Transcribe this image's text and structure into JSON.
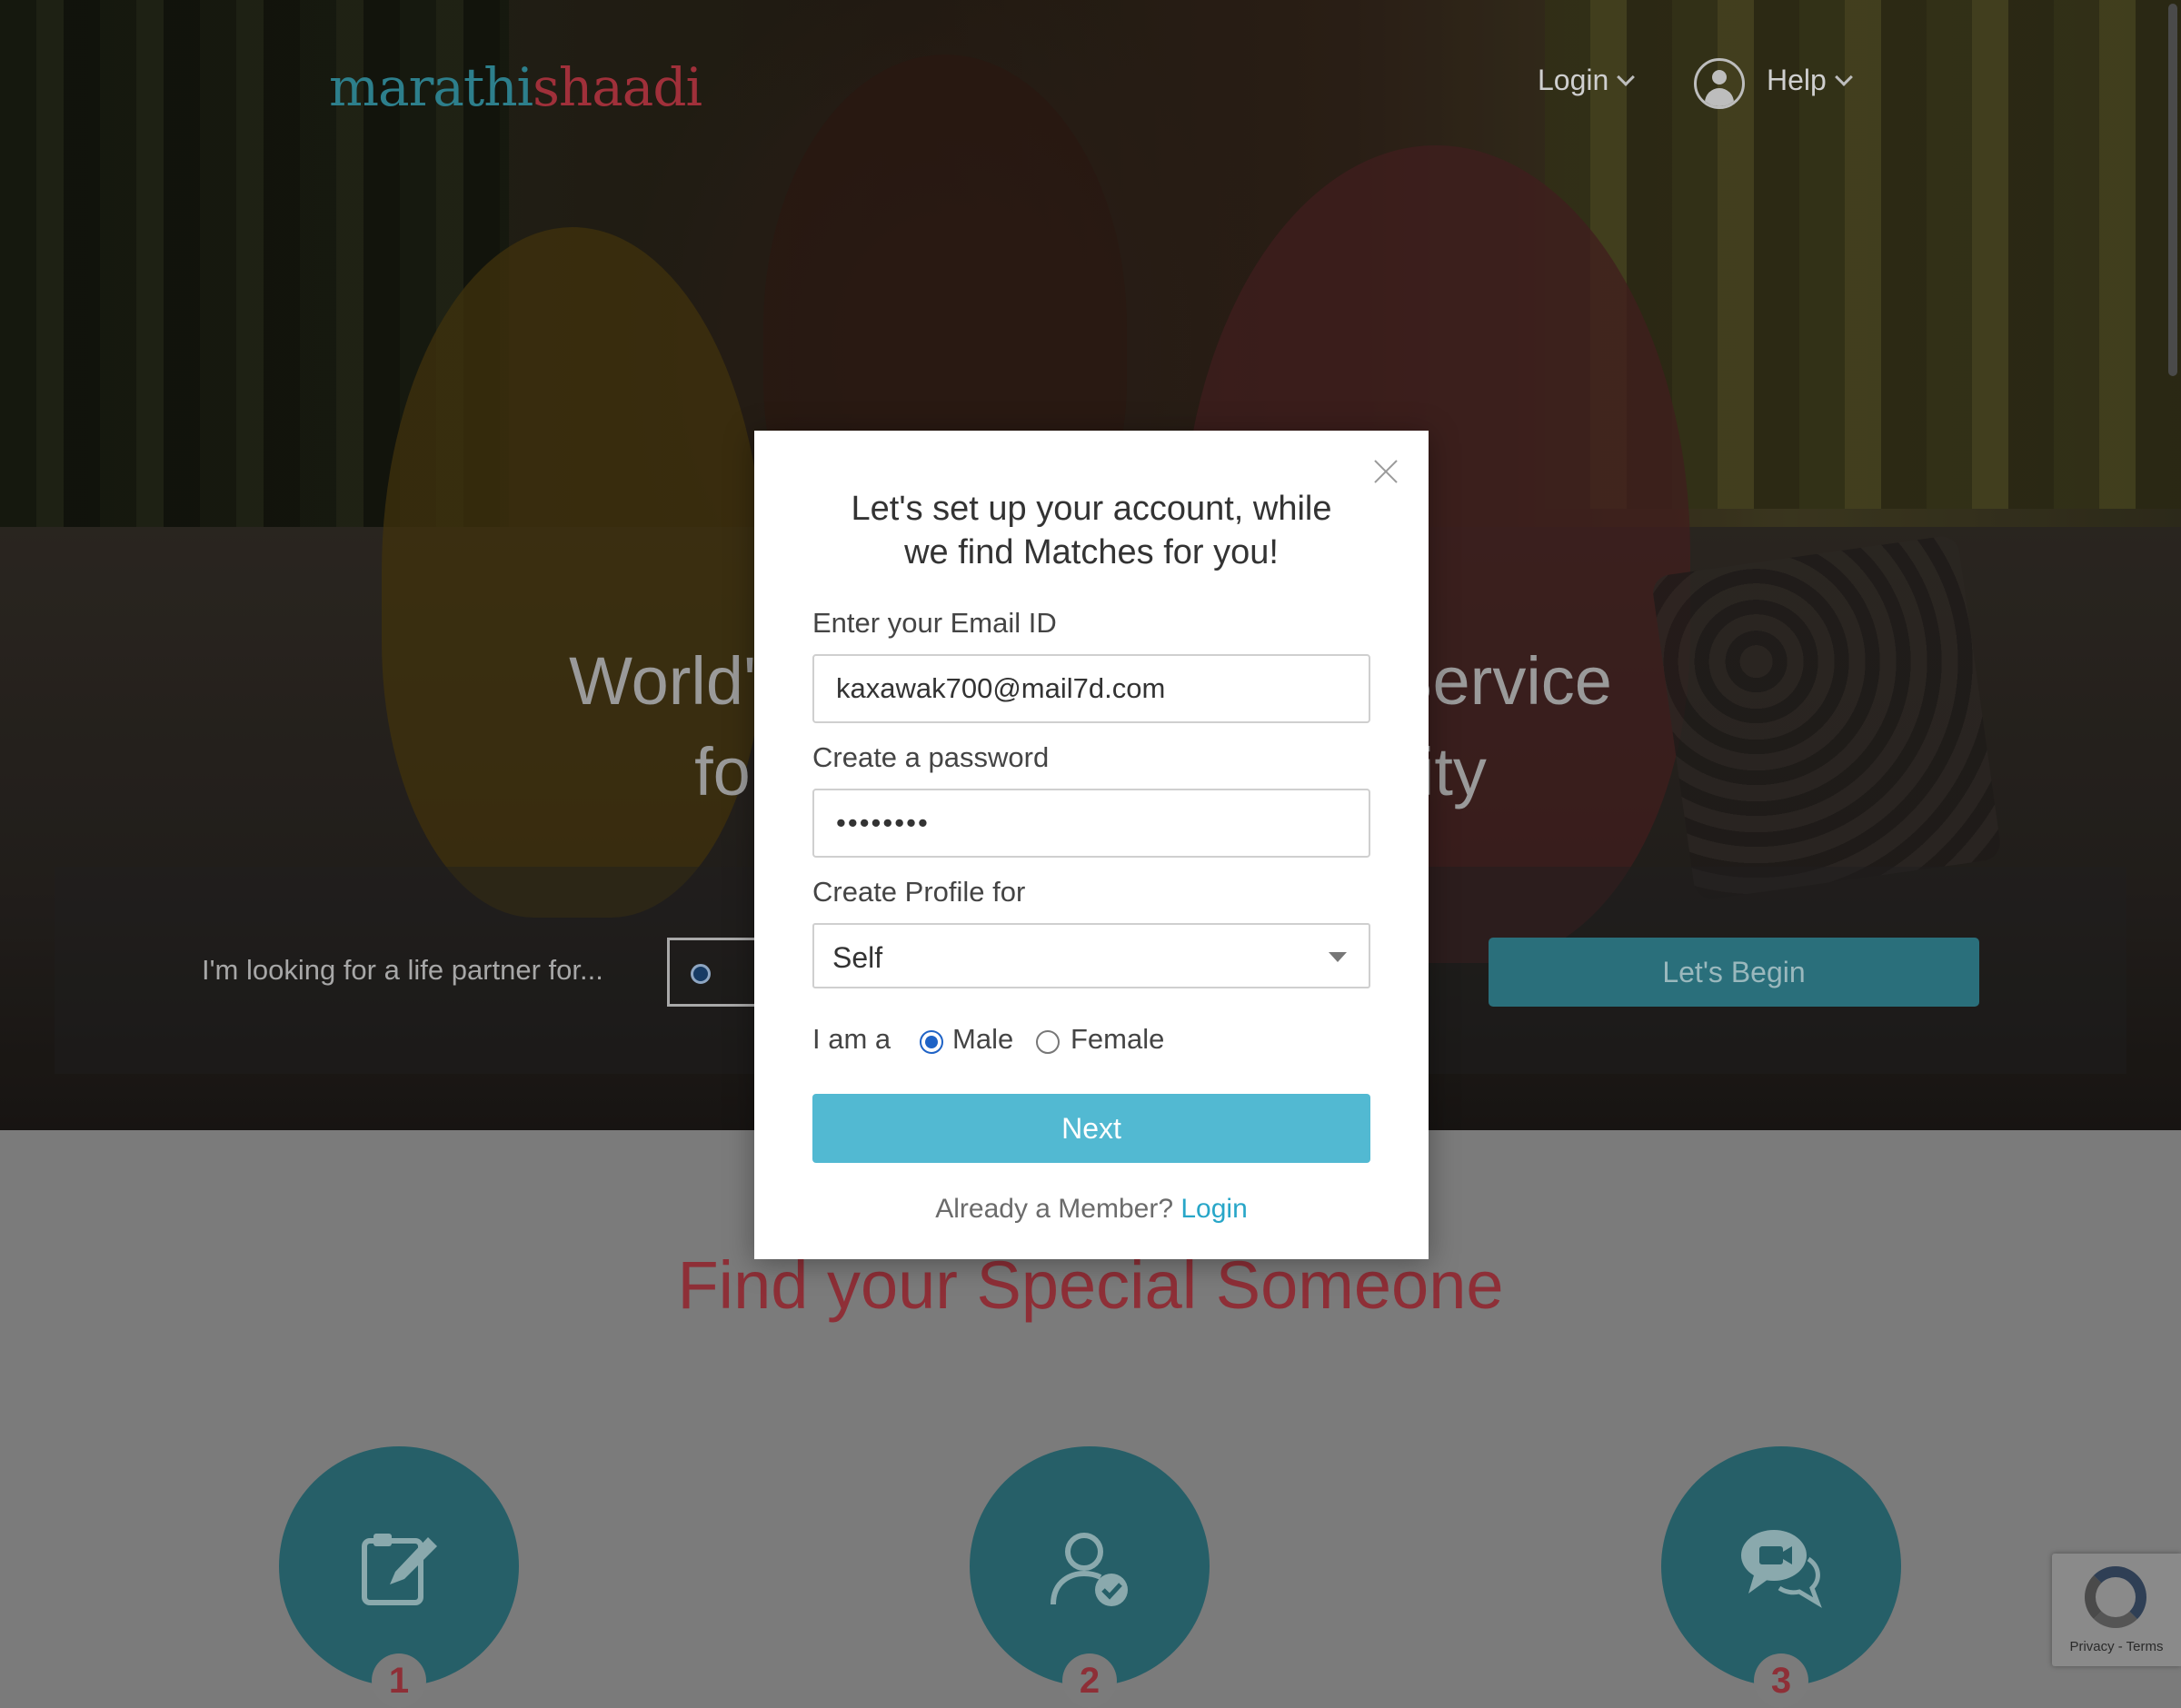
{
  "header": {
    "logo_part1": "marathi",
    "logo_part2": "shaadi",
    "login_label": "Login",
    "help_label": "Help"
  },
  "hero": {
    "title_line1": "World's No.1 Matchmaking Service",
    "title_line2": "for the Marathi Community",
    "search_label": "I'm looking for a life partner for...",
    "begin_label": "Let's Begin"
  },
  "section": {
    "heading": "Find your Special Someone",
    "steps": [
      {
        "number": "1",
        "icon": "edit-profile-icon"
      },
      {
        "number": "2",
        "icon": "verified-user-icon"
      },
      {
        "number": "3",
        "icon": "video-chat-icon"
      }
    ]
  },
  "modal": {
    "title_line1": "Let's set up your account, while",
    "title_line2": "we find Matches for you!",
    "email_label": "Enter your Email ID",
    "email_value": "kaxawak700@mail7d.com",
    "password_label": "Create a password",
    "password_value": "password",
    "profile_label": "Create Profile for",
    "profile_value": "Self",
    "gender_label": "I am a",
    "gender_options": [
      "Male",
      "Female"
    ],
    "gender_selected": "Male",
    "next_label": "Next",
    "member_text": "Already a Member?",
    "member_link": "Login"
  },
  "recaptcha": {
    "text": "Privacy - Terms"
  },
  "colors": {
    "accent": "#52b9d2",
    "brand_teal": "#2d7f8c",
    "brand_red": "#a0303a",
    "link": "#28a6c8"
  }
}
